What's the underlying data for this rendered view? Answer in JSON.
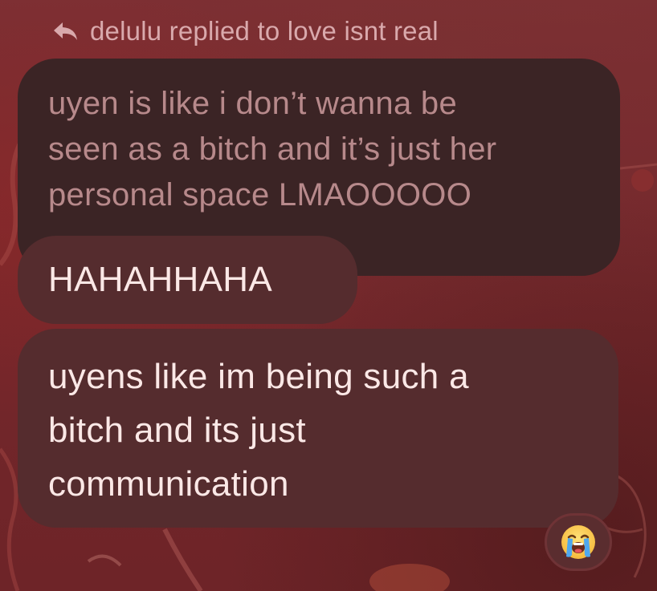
{
  "reply_header": {
    "icon": "reply-arrow-icon",
    "text": "delulu replied to love isnt real"
  },
  "quoted_message": {
    "lines": [
      "uyen is like i don’t wanna be",
      "seen as a bitch and it’s just her",
      "personal space LMAOOOOO"
    ]
  },
  "messages": [
    {
      "lines": [
        "HAHAHHAHA"
      ]
    },
    {
      "lines": [
        "uyens like im being such a",
        "bitch and its just",
        "communication"
      ]
    }
  ],
  "reaction": {
    "emoji": "loudly-crying-face-icon"
  },
  "colors": {
    "background": "#7a2a2e",
    "quoted_bubble": "#3b2425",
    "message_bubble": "#552c2e",
    "quoted_text": "#b7898b",
    "message_text": "#fbe8e6",
    "header_text": "#d9a9ac"
  }
}
